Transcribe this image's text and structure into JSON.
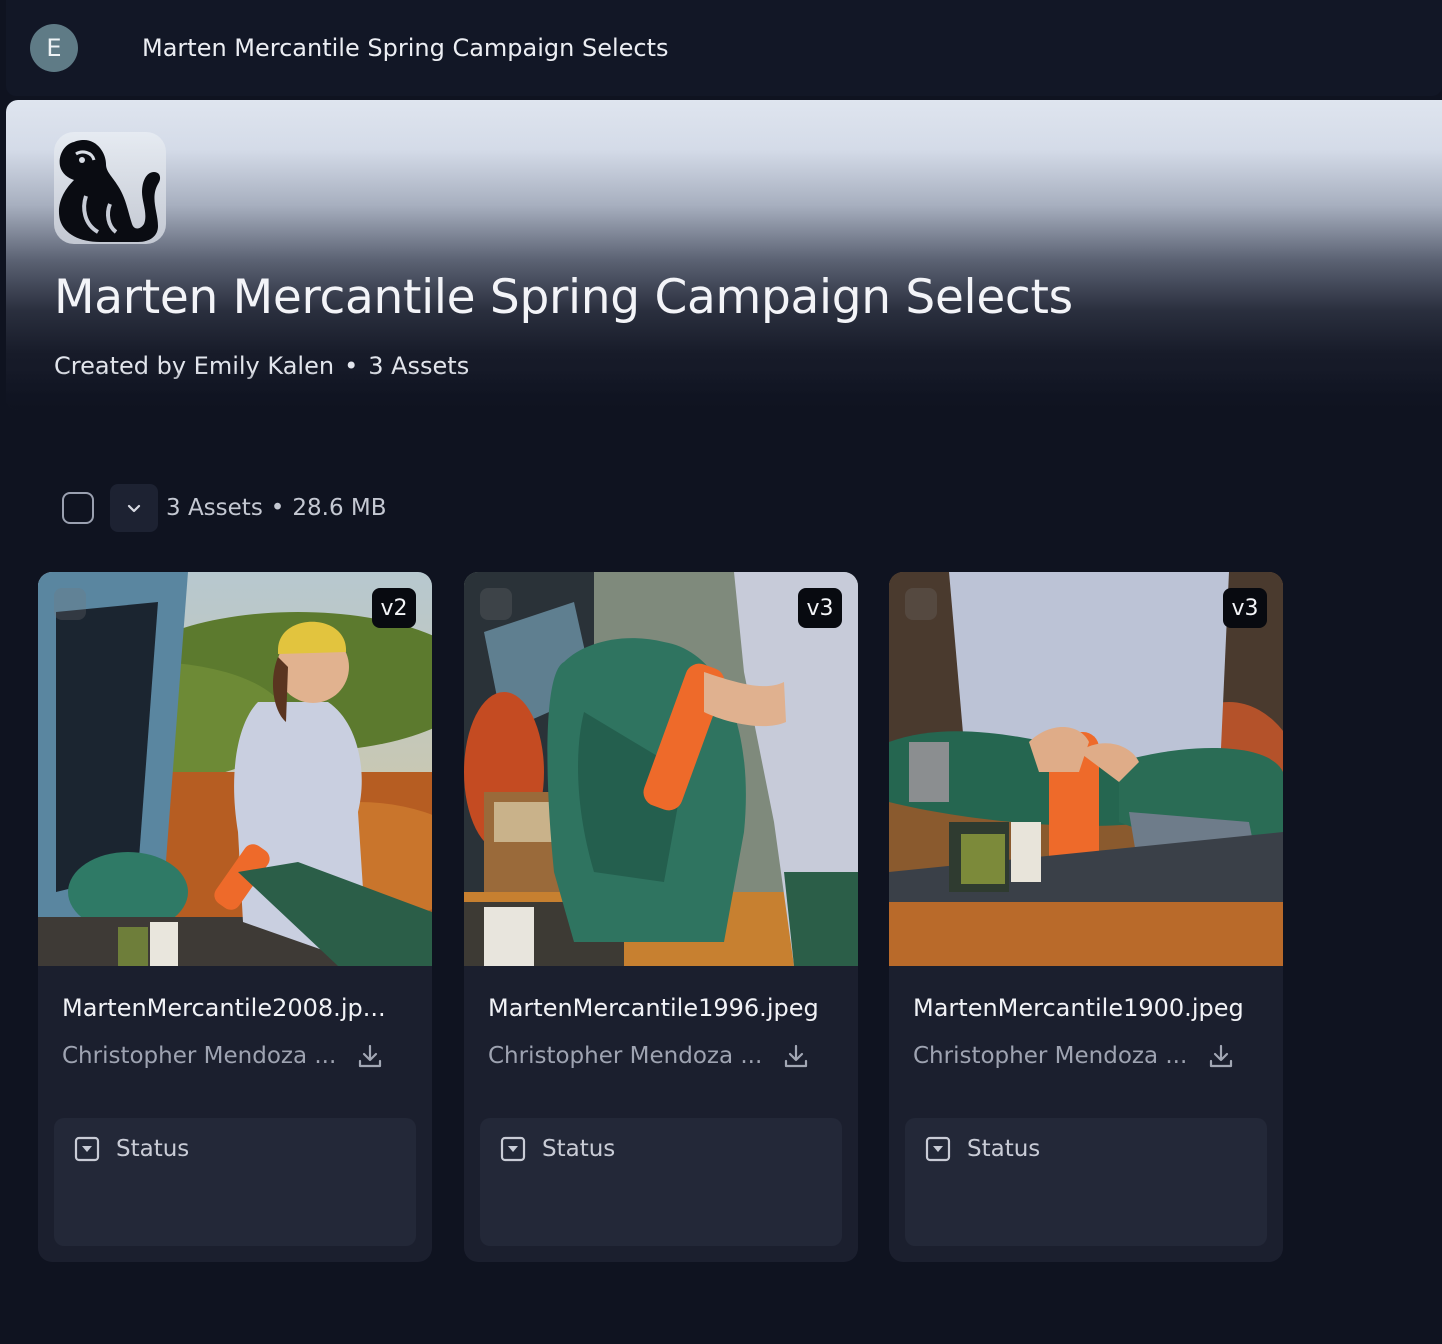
{
  "topbar": {
    "avatar_initial": "E",
    "title": "Marten Mercantile Spring Campaign Selects"
  },
  "hero": {
    "title": "Marten Mercantile Spring Campaign Selects",
    "created_by": "Created by Emily Kalen",
    "separator": "•",
    "asset_count": "3 Assets"
  },
  "toolbar": {
    "count": "3 Assets",
    "separator": "•",
    "size": "28.6 MB"
  },
  "assets": [
    {
      "version": "v2",
      "filename": "MartenMercantile2008.jp...",
      "author": "Christopher Mendoza ...",
      "status_label": "Status"
    },
    {
      "version": "v3",
      "filename": "MartenMercantile1996.jpeg",
      "author": "Christopher Mendoza ...",
      "status_label": "Status"
    },
    {
      "version": "v3",
      "filename": "MartenMercantile1900.jpeg",
      "author": "Christopher Mendoza ...",
      "status_label": "Status"
    }
  ],
  "icons": {
    "logo": "marten-logo-icon",
    "dropdown": "chevron-down-icon",
    "download": "download-icon",
    "status": "status-dropdown-icon"
  }
}
